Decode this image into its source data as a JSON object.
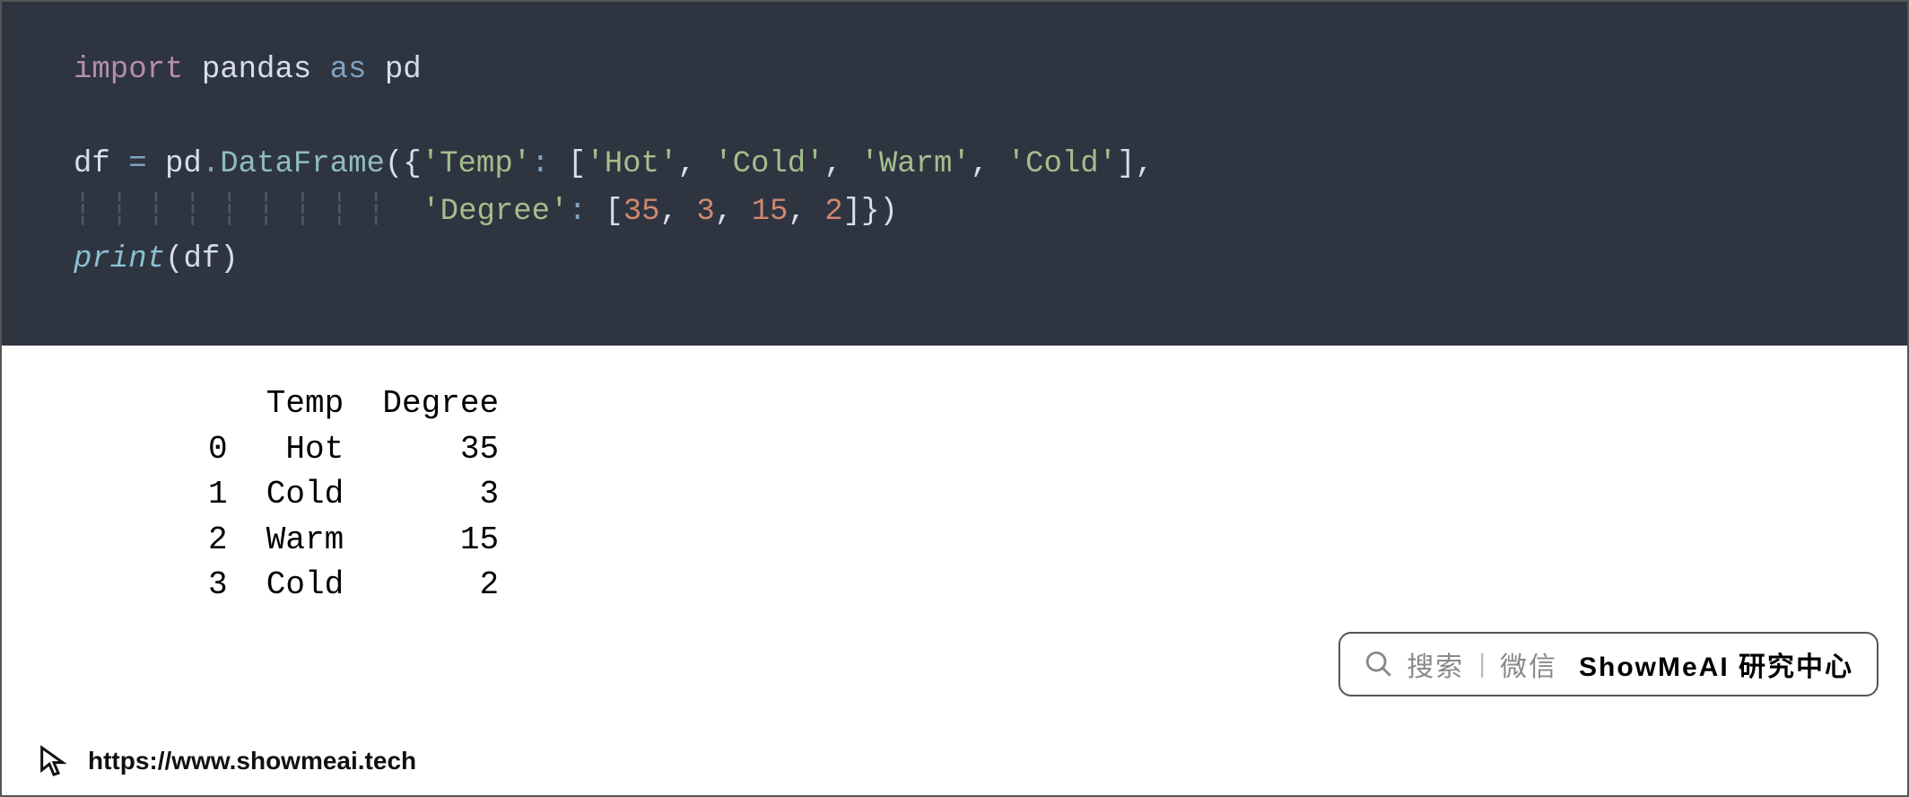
{
  "code": {
    "line1": {
      "import": "import",
      "mod": "pandas",
      "as": "as",
      "alias": "pd"
    },
    "line2": {
      "lhs": "df",
      "eq": "=",
      "obj": "pd",
      "dot": ".",
      "cls": "DataFrame",
      "open": "({",
      "k1": "'Temp'",
      "colon": ":",
      "lb": "[",
      "v1": "'Hot'",
      "c": ",",
      "v2": "'Cold'",
      "v3": "'Warm'",
      "v4": "'Cold'",
      "rb": "]",
      "trail": ","
    },
    "line3": {
      "k2": "'Degree'",
      "colon": ":",
      "lb": "[",
      "n1": "35",
      "c": ",",
      "n2": "3",
      "n3": "15",
      "n4": "2",
      "rb": "]",
      "close": "})"
    },
    "line4": {
      "fn": "print",
      "open": "(",
      "arg": "df",
      "close": ")"
    }
  },
  "output": {
    "header": "   Temp  Degree",
    "rows": [
      "0   Hot      35",
      "1  Cold       3",
      "2  Warm      15",
      "3  Cold       2"
    ]
  },
  "footer": {
    "url": "https://www.showmeai.tech"
  },
  "badge": {
    "search": "搜索",
    "wechat": "微信",
    "brand": "ShowMeAI 研究中心"
  }
}
